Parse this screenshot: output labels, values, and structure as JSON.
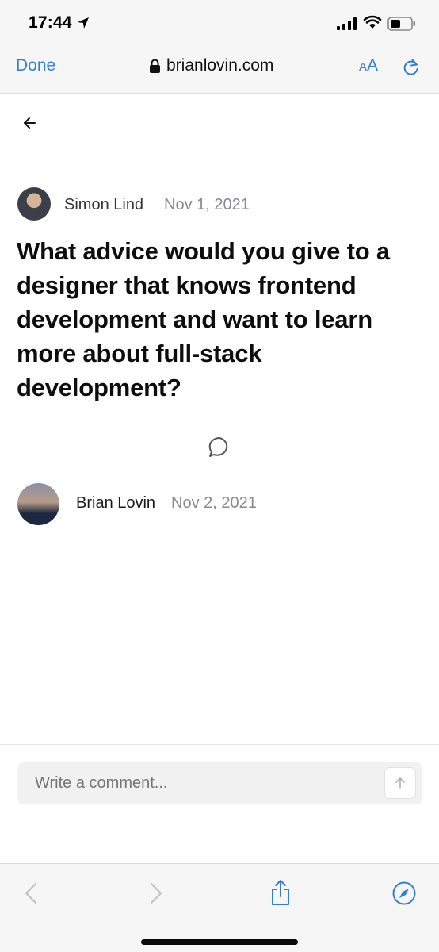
{
  "status_bar": {
    "time": "17:44"
  },
  "browser": {
    "done_label": "Done",
    "url": "brianlovin.com",
    "text_size_label_large": "A",
    "text_size_label_small": "A"
  },
  "question": {
    "author": "Simon Lind",
    "date": "Nov 1, 2021",
    "title": "What advice would you give to a designer that knows frontend development and want to learn more about full-stack development?"
  },
  "reply": {
    "author": "Brian Lovin",
    "date": "Nov 2, 2021"
  },
  "comment_form": {
    "placeholder": "Write a comment..."
  },
  "icons": {
    "accent_color": "#2f7fd8",
    "back": "arrow-left-icon",
    "comment": "speech-bubble-icon",
    "send": "arrow-up-icon",
    "share": "share-icon",
    "compass": "compass-icon"
  }
}
